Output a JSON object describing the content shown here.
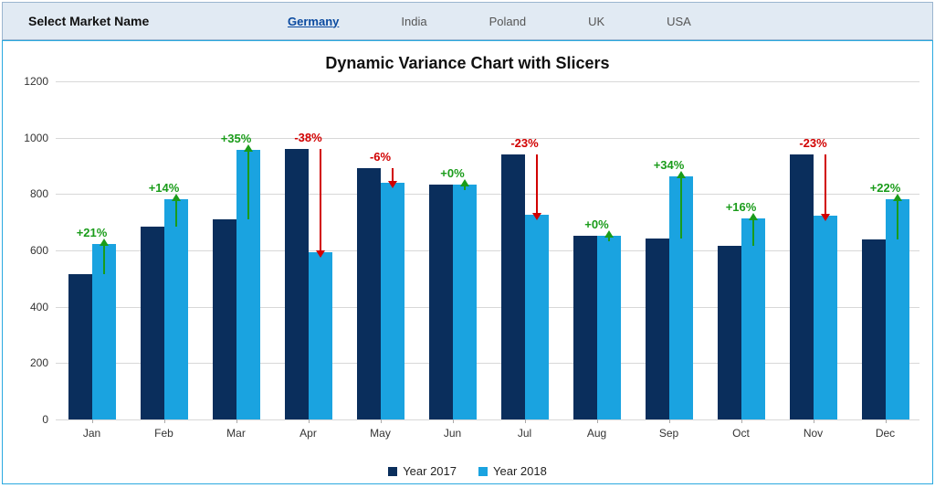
{
  "slicer": {
    "label": "Select Market Name",
    "items": [
      "Germany",
      "India",
      "Poland",
      "UK",
      "USA"
    ],
    "selected_index": 0
  },
  "chart_data": {
    "type": "bar",
    "title": "Dynamic Variance Chart with Slicers",
    "categories": [
      "Jan",
      "Feb",
      "Mar",
      "Apr",
      "May",
      "Jun",
      "Jul",
      "Aug",
      "Sep",
      "Oct",
      "Nov",
      "Dec"
    ],
    "series": [
      {
        "name": "Year 2017",
        "color": "#0a2e5c",
        "values": [
          516,
          685,
          709,
          960,
          891,
          834,
          942,
          651,
          643,
          616,
          940,
          640
        ]
      },
      {
        "name": "Year 2018",
        "color": "#1aa3e0",
        "values": [
          624,
          781,
          957,
          595,
          839,
          834,
          725,
          651,
          862,
          714,
          724,
          781
        ]
      }
    ],
    "variance_pct": [
      21,
      14,
      35,
      -38,
      -6,
      0,
      -23,
      0,
      34,
      16,
      -23,
      22
    ],
    "ylim": [
      0,
      1200
    ],
    "yticks": [
      0,
      200,
      400,
      600,
      800,
      1000,
      1200
    ],
    "xlabel": "",
    "ylabel": "",
    "legend_position": "bottom"
  }
}
